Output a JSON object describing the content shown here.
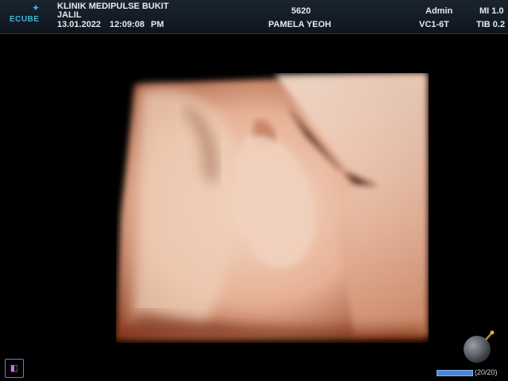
{
  "header": {
    "logo_text": "ECUBE",
    "clinic_line1": "KLINIK MEDIPULSE BUKIT",
    "clinic_line2": "JALIL",
    "date": "13.01.2022",
    "time": "12:09:08",
    "ampm": "PM",
    "patient_id": "5620",
    "patient_name": "PAMELA YEOH",
    "user": "Admin",
    "probe": "VC1-6T",
    "mi": "MI 1.0",
    "tib": "TIB 0.2"
  },
  "footer": {
    "cine_count": "(20/20)",
    "cine_progress": 1.0
  },
  "colors": {
    "accent": "#3fb6d8",
    "skin_light": "#f4dccb",
    "skin_mid": "#e0a98c",
    "skin_dark": "#8f3f22"
  }
}
